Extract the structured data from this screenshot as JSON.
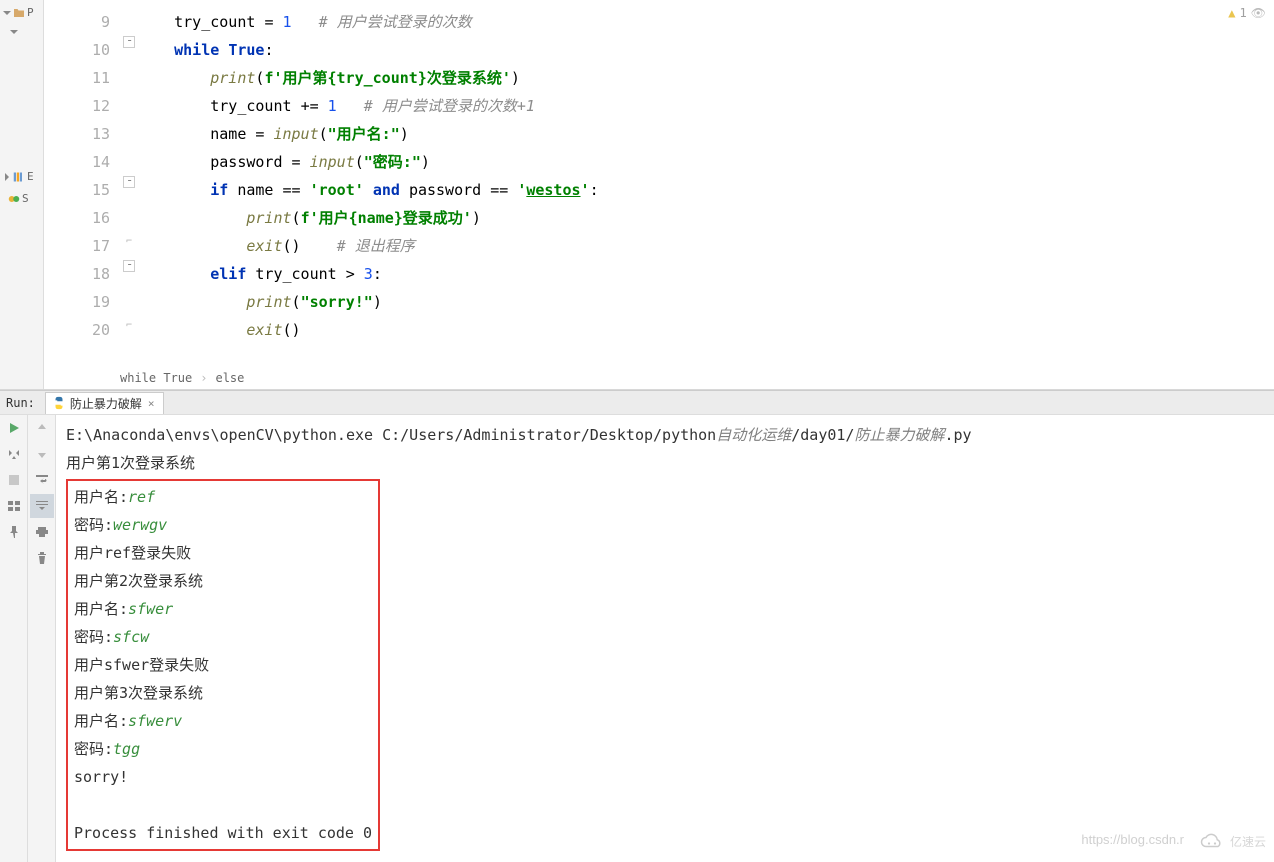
{
  "editor": {
    "lineNumbers": [
      "9",
      "10",
      "11",
      "12",
      "13",
      "14",
      "15",
      "16",
      "17",
      "18",
      "19",
      "20"
    ],
    "lines": [
      {
        "indent": "    ",
        "tokens": [
          {
            "t": "try_count ",
            "c": "ident"
          },
          {
            "t": "= ",
            "c": "op"
          },
          {
            "t": "1",
            "c": "num"
          },
          {
            "t": "   ",
            "c": "op"
          },
          {
            "t": "# 用户尝试登录的次数",
            "c": "cmt"
          }
        ]
      },
      {
        "indent": "    ",
        "tokens": [
          {
            "t": "while ",
            "c": "kw"
          },
          {
            "t": "True",
            "c": "kw"
          },
          {
            "t": ":",
            "c": "op"
          }
        ]
      },
      {
        "indent": "        ",
        "tokens": [
          {
            "t": "print",
            "c": "fn"
          },
          {
            "t": "(",
            "c": "op"
          },
          {
            "t": "f'用户第{try_count}次登录系统'",
            "c": "str"
          },
          {
            "t": ")",
            "c": "op"
          }
        ]
      },
      {
        "indent": "        ",
        "tokens": [
          {
            "t": "try_count ",
            "c": "ident"
          },
          {
            "t": "+= ",
            "c": "op"
          },
          {
            "t": "1",
            "c": "num"
          },
          {
            "t": "   ",
            "c": "op"
          },
          {
            "t": "# 用户尝试登录的次数+1",
            "c": "cmt"
          }
        ]
      },
      {
        "indent": "        ",
        "tokens": [
          {
            "t": "name ",
            "c": "ident"
          },
          {
            "t": "= ",
            "c": "op"
          },
          {
            "t": "input",
            "c": "fn"
          },
          {
            "t": "(",
            "c": "op"
          },
          {
            "t": "\"用户名:\"",
            "c": "str"
          },
          {
            "t": ")",
            "c": "op"
          }
        ]
      },
      {
        "indent": "        ",
        "tokens": [
          {
            "t": "password ",
            "c": "ident"
          },
          {
            "t": "= ",
            "c": "op"
          },
          {
            "t": "input",
            "c": "fn"
          },
          {
            "t": "(",
            "c": "op"
          },
          {
            "t": "\"密码:\"",
            "c": "str"
          },
          {
            "t": ")",
            "c": "op"
          }
        ]
      },
      {
        "indent": "        ",
        "tokens": [
          {
            "t": "if ",
            "c": "kw"
          },
          {
            "t": "name ",
            "c": "ident"
          },
          {
            "t": "== ",
            "c": "op"
          },
          {
            "t": "'root' ",
            "c": "str"
          },
          {
            "t": "and ",
            "c": "kw"
          },
          {
            "t": "password ",
            "c": "ident"
          },
          {
            "t": "== ",
            "c": "op"
          },
          {
            "t": "'",
            "c": "str"
          },
          {
            "t": "westos",
            "c": "str underline"
          },
          {
            "t": "'",
            "c": "str"
          },
          {
            "t": ":",
            "c": "op"
          }
        ]
      },
      {
        "indent": "            ",
        "tokens": [
          {
            "t": "print",
            "c": "fn"
          },
          {
            "t": "(",
            "c": "op"
          },
          {
            "t": "f'用户{name}登录成功'",
            "c": "str"
          },
          {
            "t": ")",
            "c": "op"
          }
        ]
      },
      {
        "indent": "            ",
        "tokens": [
          {
            "t": "exit",
            "c": "fn"
          },
          {
            "t": "()",
            "c": "op"
          },
          {
            "t": "    ",
            "c": "op"
          },
          {
            "t": "# 退出程序",
            "c": "cmt"
          }
        ]
      },
      {
        "indent": "        ",
        "tokens": [
          {
            "t": "elif ",
            "c": "kw"
          },
          {
            "t": "try_count ",
            "c": "ident"
          },
          {
            "t": "> ",
            "c": "op"
          },
          {
            "t": "3",
            "c": "num"
          },
          {
            "t": ":",
            "c": "op"
          }
        ]
      },
      {
        "indent": "            ",
        "tokens": [
          {
            "t": "print",
            "c": "fn"
          },
          {
            "t": "(",
            "c": "op"
          },
          {
            "t": "\"sorry!\"",
            "c": "str"
          },
          {
            "t": ")",
            "c": "op"
          }
        ]
      },
      {
        "indent": "            ",
        "tokens": [
          {
            "t": "exit",
            "c": "fn"
          },
          {
            "t": "()",
            "c": "op"
          }
        ]
      }
    ],
    "breadcrumb": [
      "while True",
      "else"
    ],
    "warningCount": "1"
  },
  "run": {
    "label": "Run:",
    "tabName": "防止暴力破解",
    "command": {
      "exe": "E:\\Anaconda\\envs\\openCV\\python.exe ",
      "path": "C:/Users/Administrator/Desktop/python",
      "zh1": "自动化运维",
      "slash1": "/day01/",
      "zh2": "防止暴力破解",
      "ext": ".py"
    },
    "outputFirst": "用户第1次登录系统",
    "boxedLines": [
      {
        "parts": [
          {
            "t": "用户名:",
            "c": ""
          },
          {
            "t": "ref",
            "c": "input-val"
          }
        ]
      },
      {
        "parts": [
          {
            "t": "密码:",
            "c": ""
          },
          {
            "t": "werwgv",
            "c": "input-val"
          }
        ]
      },
      {
        "parts": [
          {
            "t": "用户ref登录失败",
            "c": ""
          }
        ]
      },
      {
        "parts": [
          {
            "t": "用户第2次登录系统",
            "c": ""
          }
        ]
      },
      {
        "parts": [
          {
            "t": "用户名:",
            "c": ""
          },
          {
            "t": "sfwer",
            "c": "input-val"
          }
        ]
      },
      {
        "parts": [
          {
            "t": "密码:",
            "c": ""
          },
          {
            "t": "sfcw",
            "c": "input-val"
          }
        ]
      },
      {
        "parts": [
          {
            "t": "用户sfwer登录失败",
            "c": ""
          }
        ]
      },
      {
        "parts": [
          {
            "t": "用户第3次登录系统",
            "c": ""
          }
        ]
      },
      {
        "parts": [
          {
            "t": "用户名:",
            "c": ""
          },
          {
            "t": "sfwerv",
            "c": "input-val"
          }
        ]
      },
      {
        "parts": [
          {
            "t": "密码:",
            "c": ""
          },
          {
            "t": "tgg",
            "c": "input-val"
          }
        ]
      },
      {
        "parts": [
          {
            "t": "sorry!",
            "c": ""
          }
        ]
      },
      {
        "parts": [
          {
            "t": "",
            "c": ""
          }
        ]
      },
      {
        "parts": [
          {
            "t": "Process finished with exit code 0",
            "c": "proc-finish"
          }
        ]
      }
    ]
  },
  "watermark": {
    "url": "https://blog.csdn.r",
    "brand": "亿速云"
  }
}
